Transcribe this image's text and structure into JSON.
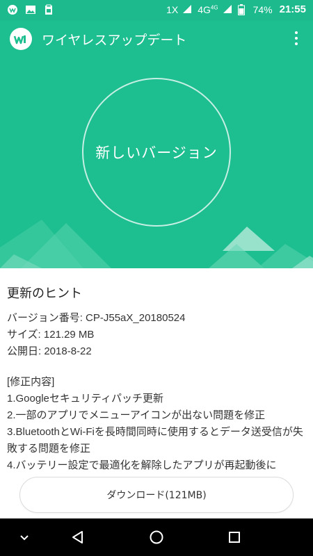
{
  "status_bar": {
    "signal_label": "1X",
    "network_label": "4G",
    "network_sup": "4G",
    "battery": "74%",
    "time": "21:55"
  },
  "app_bar": {
    "title": "ワイヤレスアップデート"
  },
  "hero": {
    "circle_text": "新しいバージョン"
  },
  "tips": {
    "title": "更新のヒント",
    "version": "バージョン番号: CP-J55aX_20180524",
    "size": "サイズ: 121.29 MB",
    "release_date": "公開日: 2018-8-22"
  },
  "changes": {
    "header": "[修正内容]",
    "items": [
      "1.Googleセキュリティパッチ更新",
      "2.一部のアプリでメニューアイコンが出ない問題を修正",
      "3.BluetoothとWi-Fiを長時間同時に使用するとデータ送受信が失敗する問題を修正",
      "4.バッテリー設定で最適化を解除したアプリが再起動後に"
    ]
  },
  "download": {
    "label": "ダウンロード(121MB)"
  },
  "colors": {
    "accent": "#1dbe90",
    "status_bar": "#1dba8e"
  }
}
